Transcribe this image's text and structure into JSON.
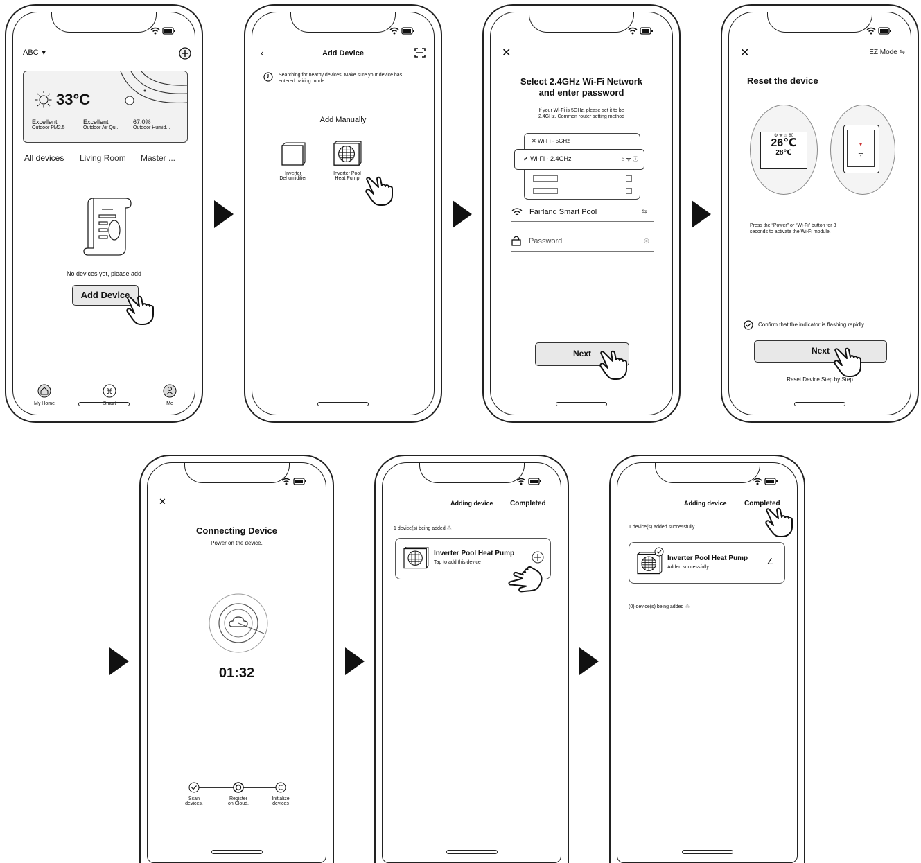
{
  "screen1": {
    "home_name": "ABC",
    "temperature": "33°C",
    "metrics": [
      {
        "value": "Excellent",
        "label": "Outdoor PM2.5"
      },
      {
        "value": "Excellent",
        "label": "Outdoor Air Qu..."
      },
      {
        "value": "67.0%",
        "label": "Outdoor Humid..."
      }
    ],
    "tabs": [
      "All devices",
      "Living Room",
      "Master ..."
    ],
    "empty_text": "No devices yet, please add",
    "add_button": "Add  Device",
    "nav": [
      "My Home",
      "Smart",
      "Me"
    ]
  },
  "screen2": {
    "title": "Add  Device",
    "search_text": "Searching for nearby devices. Make sure your device has entered pairing mode.",
    "section": "Add Manually",
    "devices": [
      {
        "line1": "Inverter",
        "line2": "Dehumidifier"
      },
      {
        "line1": "Inverter Pool",
        "line2": "Heat Pump"
      }
    ]
  },
  "screen3": {
    "title_line1": "Select 2.4GHz Wi-Fi Network",
    "title_line2": "and enter password",
    "subtitle_line1": "If your Wi-Fi is 5GHz, please set it to be",
    "subtitle_line2": "2.4GHz. Common router setting method",
    "wifi_5g": "Wi-Fi - 5GHz",
    "wifi_24g": "Wi-Fi - 2.4GHz",
    "network_name": "Fairland Smart Pool",
    "password_placeholder": "Password",
    "next": "Next"
  },
  "screen4": {
    "mode": "EZ Mode",
    "title": "Reset the device",
    "display_top": "26℃",
    "display_bottom": "28℃",
    "instruction_line1": "Press the “Power” or “Wi-Fi” button for 3",
    "instruction_line2": "seconds to activate the Wi-Fi module.",
    "confirm": "Confirm that the indicator is flashing rapidly.",
    "next": "Next",
    "reset_link": "Reset Device Step by Step"
  },
  "screen5": {
    "title": "Connecting Device",
    "subtitle": "Power on the device.",
    "timer": "01:32",
    "steps": [
      {
        "line1": "Scan",
        "line2": "devices."
      },
      {
        "line1": "Register",
        "line2": "on Cloud."
      },
      {
        "line1": "Initialize",
        "line2": "devices"
      }
    ]
  },
  "screen6": {
    "tab_adding": "Adding device",
    "tab_completed": "Completed",
    "status": "1 device(s) being added",
    "device_name": "Inverter Pool Heat Pump",
    "device_sub": "Tap to add this device"
  },
  "screen7": {
    "tab_adding": "Adding device",
    "tab_completed": "Completed",
    "status": "1 device(s) added successfully",
    "device_name": "Inverter Pool Heat Pump",
    "device_sub": "Added successfully",
    "pending": "(0) device(s) being added"
  }
}
